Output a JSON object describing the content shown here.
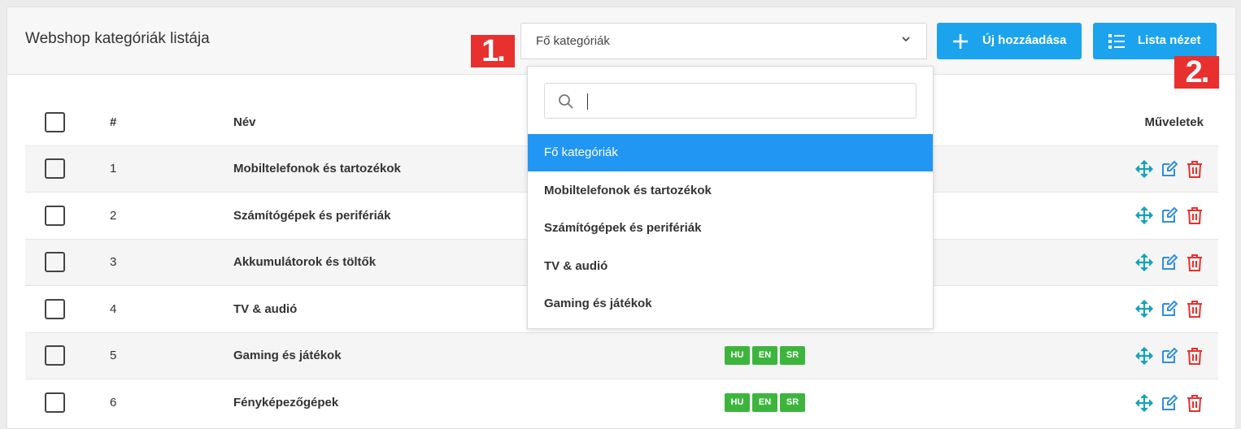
{
  "header": {
    "title": "Webshop kategóriák listája",
    "select_value": "Fő kategóriák",
    "add_button": "Új hozzáadása",
    "list_button": "Lista nézet"
  },
  "markers": {
    "m1": "1.",
    "m2": "2."
  },
  "table": {
    "columns": {
      "num": "#",
      "name": "Név",
      "actions": "Műveletek"
    },
    "rows": [
      {
        "num": "1",
        "name": "Mobiltelefonok és tartozékok",
        "langs": []
      },
      {
        "num": "2",
        "name": "Számítógépek és perifériák",
        "langs": []
      },
      {
        "num": "3",
        "name": "Akkumulátorok és töltők",
        "langs": []
      },
      {
        "num": "4",
        "name": "TV & audió",
        "langs": []
      },
      {
        "num": "5",
        "name": "Gaming és játékok",
        "langs": [
          "HU",
          "EN",
          "SR"
        ]
      },
      {
        "num": "6",
        "name": "Fényképezőgépek",
        "langs": [
          "HU",
          "EN",
          "SR"
        ]
      }
    ]
  },
  "dropdown": {
    "search_value": "",
    "items": [
      {
        "label": "Fő kategóriák",
        "active": true
      },
      {
        "label": "Mobiltelefonok és tartozékok",
        "active": false
      },
      {
        "label": "Számítógépek és perifériák",
        "active": false
      },
      {
        "label": "TV & audió",
        "active": false
      },
      {
        "label": "Gaming és játékok",
        "active": false
      }
    ]
  },
  "colors": {
    "primary": "#1ca3ee",
    "active_item": "#2196f3",
    "badge": "#3db53d",
    "danger": "#e8302e",
    "move": "#17a2b8",
    "edit": "#2f8ee0"
  },
  "icons": {
    "add": "plus-icon",
    "list": "list-icon",
    "chevron": "chevron-down-icon",
    "search": "search-icon",
    "move": "move-icon",
    "edit": "edit-icon",
    "delete": "trash-icon"
  }
}
